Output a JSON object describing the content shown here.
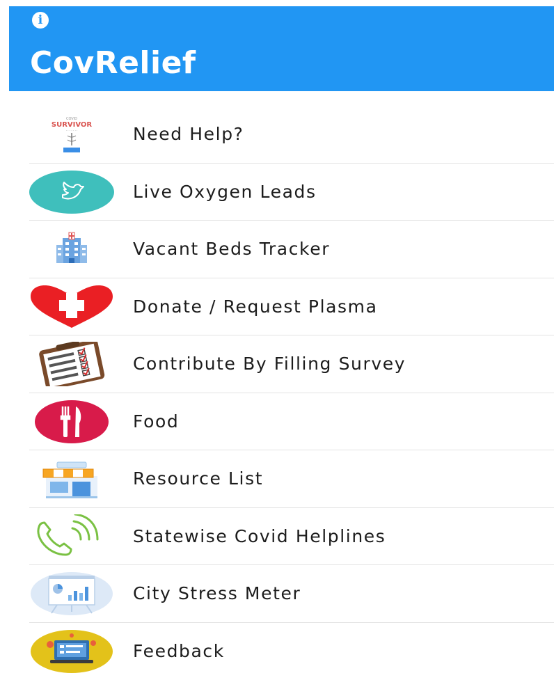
{
  "header": {
    "title": "CovRelief",
    "info_glyph": "i",
    "background_color": "#2196f3"
  },
  "menu": {
    "items": [
      {
        "label": "Need Help?",
        "icon": "covid-survivor-icon",
        "icon_text": "SURVIVOR"
      },
      {
        "label": "Live Oxygen Leads",
        "icon": "twitter-bird-icon"
      },
      {
        "label": "Vacant Beds Tracker",
        "icon": "hospital-building-icon"
      },
      {
        "label": "Donate / Request Plasma",
        "icon": "heart-cross-icon"
      },
      {
        "label": "Contribute By Filling Survey",
        "icon": "survey-clipboard-icon"
      },
      {
        "label": "Food",
        "icon": "fork-knife-icon"
      },
      {
        "label": "Resource List",
        "icon": "storefront-icon"
      },
      {
        "label": "Statewise Covid Helplines",
        "icon": "phone-ringing-icon"
      },
      {
        "label": "City Stress Meter",
        "icon": "presentation-chart-icon"
      },
      {
        "label": "Feedback",
        "icon": "feedback-laptop-icon"
      }
    ]
  }
}
